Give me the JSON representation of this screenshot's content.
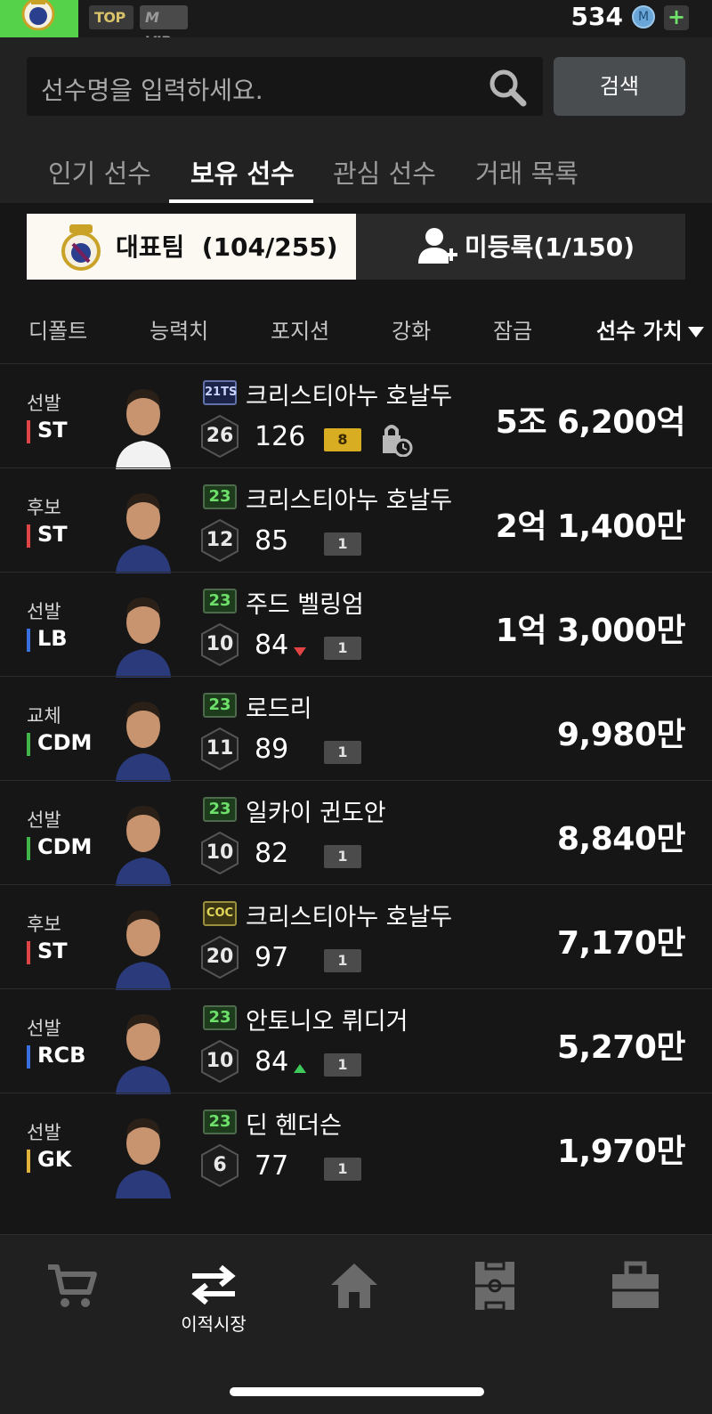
{
  "topbar": {
    "top_badge": "TOP",
    "vip_badge": "VIP",
    "coins": "534",
    "coin_letter": "M",
    "plus": "+"
  },
  "search": {
    "placeholder": "선수명을 입력하세요.",
    "button": "검색"
  },
  "tabs": [
    "인기 선수",
    "보유 선수",
    "관심 선수",
    "거래 목록"
  ],
  "team_toggle": {
    "team": "대표팀",
    "team_count": "(104/255)",
    "unregistered": "미등록(1/150)"
  },
  "sort": [
    "디폴트",
    "능력치",
    "포지션",
    "강화",
    "잠금",
    "선수 가치"
  ],
  "players": [
    {
      "status": "선발",
      "pos": "ST",
      "pos_color": "#e04444",
      "season": "21TS",
      "season_type": "tts",
      "name": "크리스티아누 호날두",
      "grade": "26",
      "ovr": "126",
      "enh": "8",
      "enh_gold": true,
      "locked": true,
      "arrow": "",
      "value": "5조 6,200억"
    },
    {
      "status": "후보",
      "pos": "ST",
      "pos_color": "#e04444",
      "season": "23",
      "season_type": "g",
      "name": "크리스티아누 호날두",
      "grade": "12",
      "ovr": "85",
      "enh": "1",
      "enh_gold": false,
      "locked": false,
      "arrow": "",
      "value": "2억 1,400만"
    },
    {
      "status": "선발",
      "pos": "LB",
      "pos_color": "#3a6fe0",
      "season": "23",
      "season_type": "g",
      "name": "주드 벨링엄",
      "grade": "10",
      "ovr": "84",
      "enh": "1",
      "enh_gold": false,
      "locked": false,
      "arrow": "down",
      "value": "1억 3,000만"
    },
    {
      "status": "교체",
      "pos": "CDM",
      "pos_color": "#3fb54a",
      "season": "23",
      "season_type": "g",
      "name": "로드리",
      "grade": "11",
      "ovr": "89",
      "enh": "1",
      "enh_gold": false,
      "locked": false,
      "arrow": "",
      "value": "9,980만"
    },
    {
      "status": "선발",
      "pos": "CDM",
      "pos_color": "#3fb54a",
      "season": "23",
      "season_type": "g",
      "name": "일카이 귄도안",
      "grade": "10",
      "ovr": "82",
      "enh": "1",
      "enh_gold": false,
      "locked": false,
      "arrow": "",
      "value": "8,840만"
    },
    {
      "status": "후보",
      "pos": "ST",
      "pos_color": "#e04444",
      "season": "COC",
      "season_type": "coc",
      "name": "크리스티아누 호날두",
      "grade": "20",
      "ovr": "97",
      "enh": "1",
      "enh_gold": false,
      "locked": false,
      "arrow": "",
      "value": "7,170만"
    },
    {
      "status": "선발",
      "pos": "RCB",
      "pos_color": "#3a6fe0",
      "season": "23",
      "season_type": "g",
      "name": "안토니오 뤼디거",
      "grade": "10",
      "ovr": "84",
      "enh": "1",
      "enh_gold": false,
      "locked": false,
      "arrow": "up",
      "value": "5,270만"
    },
    {
      "status": "선발",
      "pos": "GK",
      "pos_color": "#e0b23a",
      "season": "23",
      "season_type": "g",
      "name": "딘 헨더슨",
      "grade": "6",
      "ovr": "77",
      "enh": "1",
      "enh_gold": false,
      "locked": false,
      "arrow": "",
      "value": "1,970만"
    }
  ],
  "bottom_nav": {
    "active_label": "이적시장",
    "items": [
      "cart-icon",
      "transfer-icon",
      "home-icon",
      "field-icon",
      "bag-icon"
    ]
  }
}
